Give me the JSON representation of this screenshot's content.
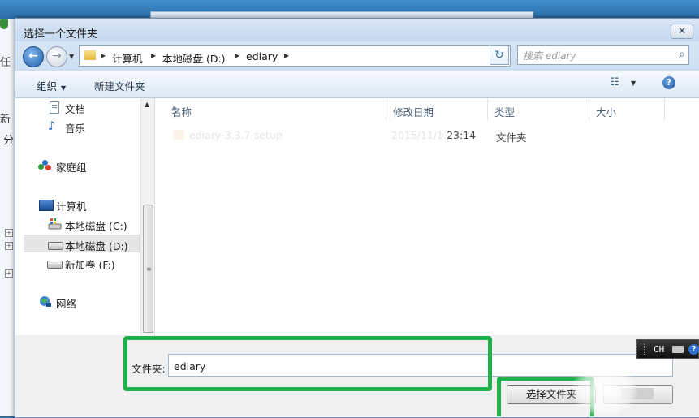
{
  "background": {
    "left_app_text_1": "任",
    "left_app_text_2": "新",
    "left_app_text_3": "分"
  },
  "dialog": {
    "title": "选择一个文件夹",
    "close_glyph": "✕"
  },
  "address_bar": {
    "crumbs": [
      "计算机",
      "本地磁盘 (D:)",
      "ediary"
    ],
    "separator_glyph": "▶",
    "refresh_glyph": "↻"
  },
  "search": {
    "placeholder": "搜索 ediary"
  },
  "toolbar": {
    "organize_label": "组织",
    "new_folder_label": "新建文件夹",
    "help_glyph": "?"
  },
  "nav_pane": {
    "items": [
      {
        "label": "文档",
        "icon": "document-icon"
      },
      {
        "label": "音乐",
        "icon": "music-icon"
      },
      {
        "label": "家庭组",
        "icon": "homegroup-icon"
      },
      {
        "label": "计算机",
        "icon": "computer-icon"
      },
      {
        "label": "本地磁盘 (C:)",
        "icon": "system-drive-icon"
      },
      {
        "label": "本地磁盘 (D:)",
        "icon": "drive-icon",
        "selected": true
      },
      {
        "label": "新加卷 (F:)",
        "icon": "drive-icon"
      },
      {
        "label": "网络",
        "icon": "network-icon"
      }
    ]
  },
  "file_list": {
    "columns": [
      "名称",
      "修改日期",
      "类型",
      "大小"
    ],
    "rows": [
      {
        "name": "ediary-3.3.7-setup",
        "date_faded": "2015/11/1",
        "time": "23:14",
        "type": "文件夹"
      }
    ]
  },
  "footer": {
    "folder_label": "文件夹:",
    "folder_value": "ediary",
    "select_button": "选择文件夹",
    "cancel_button": ""
  },
  "language_bar": {
    "lang": "CH",
    "help_glyph": "?"
  },
  "colors": {
    "highlight_green": "#20b04a",
    "accent_blue": "#2f6fc4"
  }
}
